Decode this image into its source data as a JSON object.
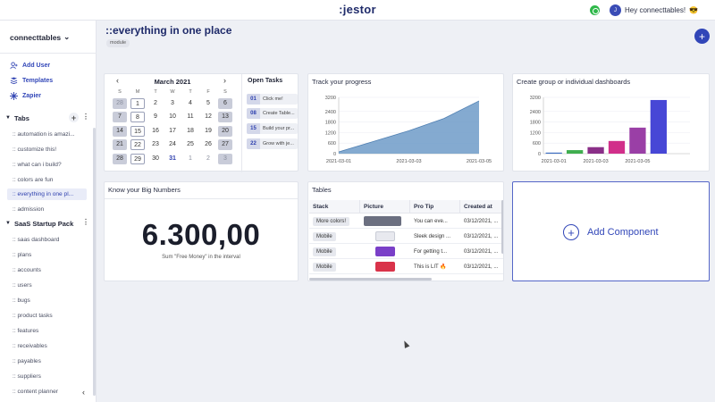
{
  "topbar": {
    "logo": ":jestor",
    "user_initial": "J",
    "greeting": "Hey connecttables!",
    "greeting_emoji": "😎"
  },
  "sidebar": {
    "workspace": "connecttables",
    "actions": [
      {
        "label": "Add User",
        "icon": "add-user-icon"
      },
      {
        "label": "Templates",
        "icon": "templates-icon"
      },
      {
        "label": "Zapier",
        "icon": "zapier-icon"
      }
    ],
    "tabs_title": "Tabs",
    "tabs": [
      ":: automation is amazi...",
      ":: customize this!",
      ":: what can i build?",
      ":: colors are fun",
      ":: everything in one pl...",
      ":: admission"
    ],
    "saas_title": "SaaS Startup Pack",
    "saas_items": [
      ":: saas dashboard",
      ":: plans",
      ":: accounts",
      ":: users",
      ":: bugs",
      ":: product tasks",
      ":: features",
      ":: receivables",
      ":: payables",
      ":: suppliers",
      ":: content planner"
    ]
  },
  "page": {
    "title": "::everything in one place",
    "badge": "module"
  },
  "calendar": {
    "month": "March 2021",
    "weekdays": [
      "S",
      "M",
      "T",
      "W",
      "T",
      "F",
      "S"
    ],
    "weeks": [
      [
        "28",
        "1",
        "2",
        "3",
        "4",
        "5",
        "6"
      ],
      [
        "7",
        "8",
        "9",
        "10",
        "11",
        "12",
        "13"
      ],
      [
        "14",
        "15",
        "16",
        "17",
        "18",
        "19",
        "20"
      ],
      [
        "21",
        "22",
        "23",
        "24",
        "25",
        "26",
        "27"
      ],
      [
        "28",
        "29",
        "30",
        "31",
        "1",
        "2",
        "3"
      ]
    ]
  },
  "open_tasks": {
    "title": "Open Tasks",
    "items": [
      {
        "num": "01",
        "text": "Click me!"
      },
      {
        "num": "08",
        "text": "Create Table..."
      },
      {
        "num": "15",
        "text": "Build your pr..."
      },
      {
        "num": "22",
        "text": "Grow with je..."
      }
    ]
  },
  "progress_card": {
    "title": "Track your progress",
    "chart_data": {
      "type": "area",
      "x": [
        "2021-03-01",
        "2021-03-02",
        "2021-03-03",
        "2021-03-04",
        "2021-03-05"
      ],
      "values": [
        100,
        700,
        1300,
        2000,
        3000
      ],
      "x_ticks": [
        "2021-03-01",
        "2021-03-03",
        "2021-03-05"
      ],
      "y_ticks": [
        "0",
        "600",
        "1200",
        "1800",
        "2400",
        "3200"
      ],
      "ylim": [
        0,
        3200
      ],
      "color": "#6f9bc8"
    }
  },
  "group_card": {
    "title": "Create group or individual dashboards",
    "chart_data": {
      "type": "bar",
      "categories": [
        "2021-03-01",
        "2021-03-02",
        "2021-03-03",
        "2021-03-04",
        "2021-03-05",
        "2021-03-06",
        "2021-03-07"
      ],
      "values": [
        60,
        200,
        370,
        720,
        1480,
        3050
      ],
      "x_ticks": [
        "2021-03-01",
        "2021-03-03",
        "2021-03-05"
      ],
      "y_ticks": [
        "0",
        "600",
        "1200",
        "1800",
        "2400",
        "3200"
      ],
      "ylim": [
        0,
        3200
      ],
      "colors": [
        "#3f6fc4",
        "#3fae4f",
        "#8a2f88",
        "#d12f8a",
        "#9a3fa6",
        "#4747d6"
      ]
    }
  },
  "big_numbers": {
    "title": "Know your Big Numbers",
    "value": "6.300,00",
    "caption": "Sum \"Free Money\" in the interval"
  },
  "tables_card": {
    "title": "Tables",
    "columns": [
      "Stack",
      "Picture",
      "Pro Tip",
      "Created at"
    ],
    "rows": [
      {
        "stack": "More colors!",
        "thumb": "#6b6f80",
        "tip": "You can eve...",
        "created": "03/12/2021, ..."
      },
      {
        "stack": "Mobile",
        "thumb": "#e8e9ef",
        "tip": "Sleek design ...",
        "created": "03/12/2021, ..."
      },
      {
        "stack": "Mobile",
        "thumb": "#7a3fc8",
        "tip": "For getting t...",
        "created": "03/12/2021, ..."
      },
      {
        "stack": "Mobile",
        "thumb": "#d9334a",
        "tip": "This is LIT 🔥",
        "created": "03/12/2021, ..."
      }
    ]
  },
  "add_component": {
    "label": "Add Component"
  }
}
